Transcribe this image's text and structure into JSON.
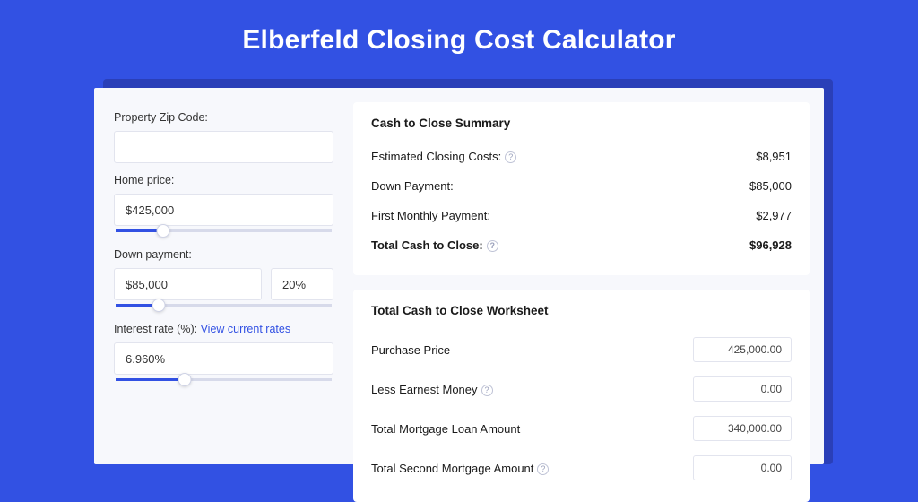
{
  "title": "Elberfeld Closing Cost Calculator",
  "form": {
    "zip_label": "Property Zip Code:",
    "zip_value": "",
    "home_price_label": "Home price:",
    "home_price_value": "$425,000",
    "home_price_slider_pct": 22,
    "down_payment_label": "Down payment:",
    "down_payment_value": "$85,000",
    "down_payment_pct": "20%",
    "down_payment_slider_pct": 20,
    "interest_label": "Interest rate (%): ",
    "interest_link": "View current rates",
    "interest_value": "6.960%",
    "interest_slider_pct": 32
  },
  "summary": {
    "title": "Cash to Close Summary",
    "rows": [
      {
        "label": "Estimated Closing Costs:",
        "help": true,
        "value": "$8,951",
        "bold": false
      },
      {
        "label": "Down Payment:",
        "help": false,
        "value": "$85,000",
        "bold": false
      },
      {
        "label": "First Monthly Payment:",
        "help": false,
        "value": "$2,977",
        "bold": false
      },
      {
        "label": "Total Cash to Close:",
        "help": true,
        "value": "$96,928",
        "bold": true
      }
    ]
  },
  "worksheet": {
    "title": "Total Cash to Close Worksheet",
    "rows": [
      {
        "label": "Purchase Price",
        "help": false,
        "value": "425,000.00"
      },
      {
        "label": "Less Earnest Money",
        "help": true,
        "value": "0.00"
      },
      {
        "label": "Total Mortgage Loan Amount",
        "help": false,
        "value": "340,000.00"
      },
      {
        "label": "Total Second Mortgage Amount",
        "help": true,
        "value": "0.00"
      }
    ]
  }
}
